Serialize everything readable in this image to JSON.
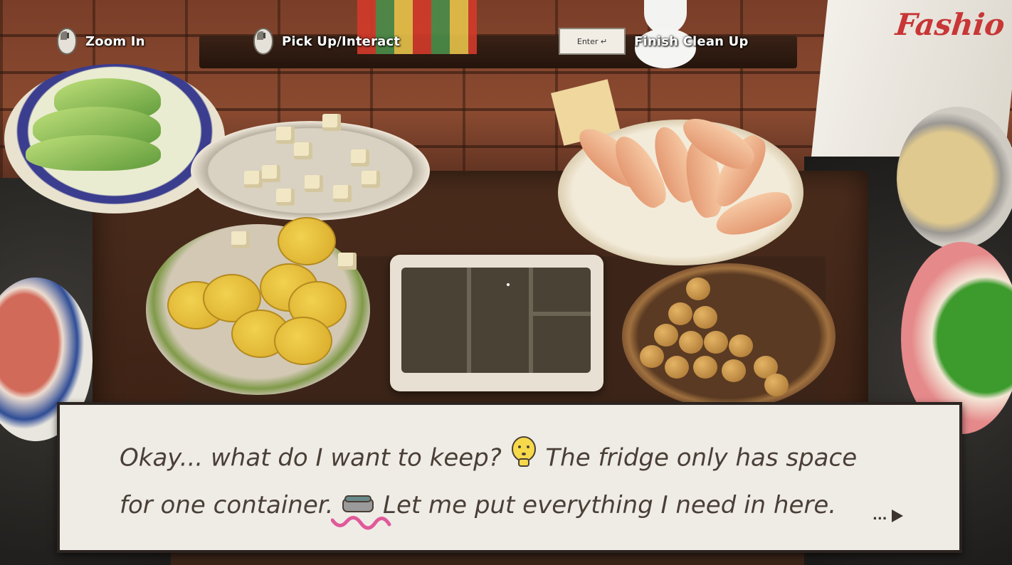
{
  "hud": {
    "zoom_label": "Zoom In",
    "pick_label": "Pick Up/Interact",
    "enter_key_label": "Enter ↵",
    "finish_label": "Finish Clean Up"
  },
  "dialogue": {
    "line1_part1": "Okay... what do I want to keep?",
    "line1_part2": "The fridge only has space",
    "line2_part1": "for one container.",
    "line2_part2": "Let me put everything I need in here.",
    "continue_label": "..."
  },
  "scene": {
    "magazine_title": "Fashio",
    "icons": [
      "mouse-icon",
      "enter-key-icon",
      "thinking-face-icon",
      "container-icon",
      "continue-arrow-icon"
    ],
    "colors": {
      "hud_text": "#ffffff",
      "dialogue_bg": "#efece6",
      "dialogue_text": "#4a3f37",
      "squiggle": "#e05a9a"
    }
  }
}
